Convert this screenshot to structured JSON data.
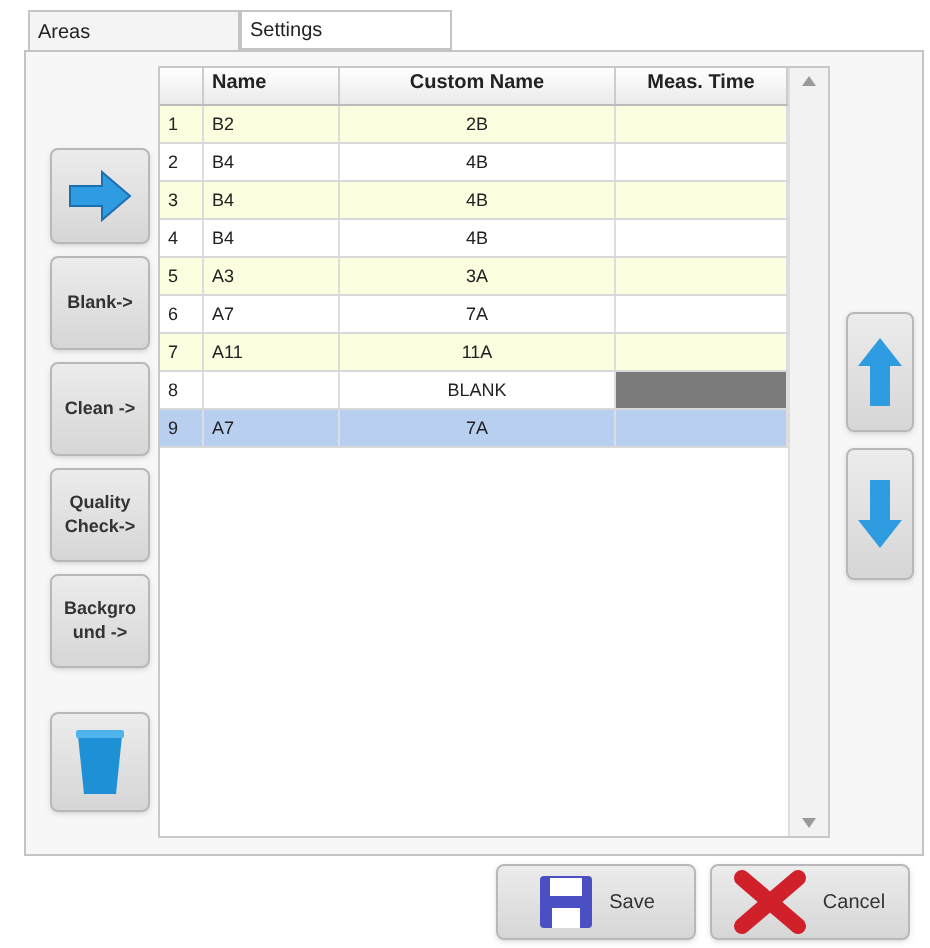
{
  "tabs": [
    {
      "label": "Areas",
      "selected": true
    },
    {
      "label": "Settings",
      "selected": false
    }
  ],
  "side_buttons": [
    {
      "kind": "arrow"
    },
    {
      "kind": "text",
      "label": "Blank->"
    },
    {
      "kind": "text",
      "label": "Clean ->"
    },
    {
      "kind": "text",
      "label": "Quality Check->"
    },
    {
      "kind": "text",
      "label": "Backgro und ->"
    },
    {
      "kind": "trash"
    }
  ],
  "table": {
    "columns": [
      "Name",
      "Custom Name",
      "Meas. Time"
    ],
    "rows": [
      {
        "index": "1",
        "name": "B2",
        "custom_name": "2B",
        "meas_time_marked": false,
        "selected": false
      },
      {
        "index": "2",
        "name": "B4",
        "custom_name": "4B",
        "meas_time_marked": false,
        "selected": false
      },
      {
        "index": "3",
        "name": "B4",
        "custom_name": "4B",
        "meas_time_marked": false,
        "selected": false
      },
      {
        "index": "4",
        "name": "B4",
        "custom_name": "4B",
        "meas_time_marked": false,
        "selected": false
      },
      {
        "index": "5",
        "name": "A3",
        "custom_name": "3A",
        "meas_time_marked": false,
        "selected": false
      },
      {
        "index": "6",
        "name": "A7",
        "custom_name": "7A",
        "meas_time_marked": false,
        "selected": false
      },
      {
        "index": "7",
        "name": "A11",
        "custom_name": "11A",
        "meas_time_marked": false,
        "selected": false
      },
      {
        "index": "8",
        "name": "",
        "custom_name": "BLANK",
        "meas_time_marked": true,
        "selected": false
      },
      {
        "index": "9",
        "name": "A7",
        "custom_name": "7A",
        "meas_time_marked": false,
        "selected": true
      }
    ]
  },
  "footer_buttons": [
    {
      "kind": "save",
      "label": "Save"
    },
    {
      "kind": "cancel",
      "label": "Cancel"
    }
  ]
}
